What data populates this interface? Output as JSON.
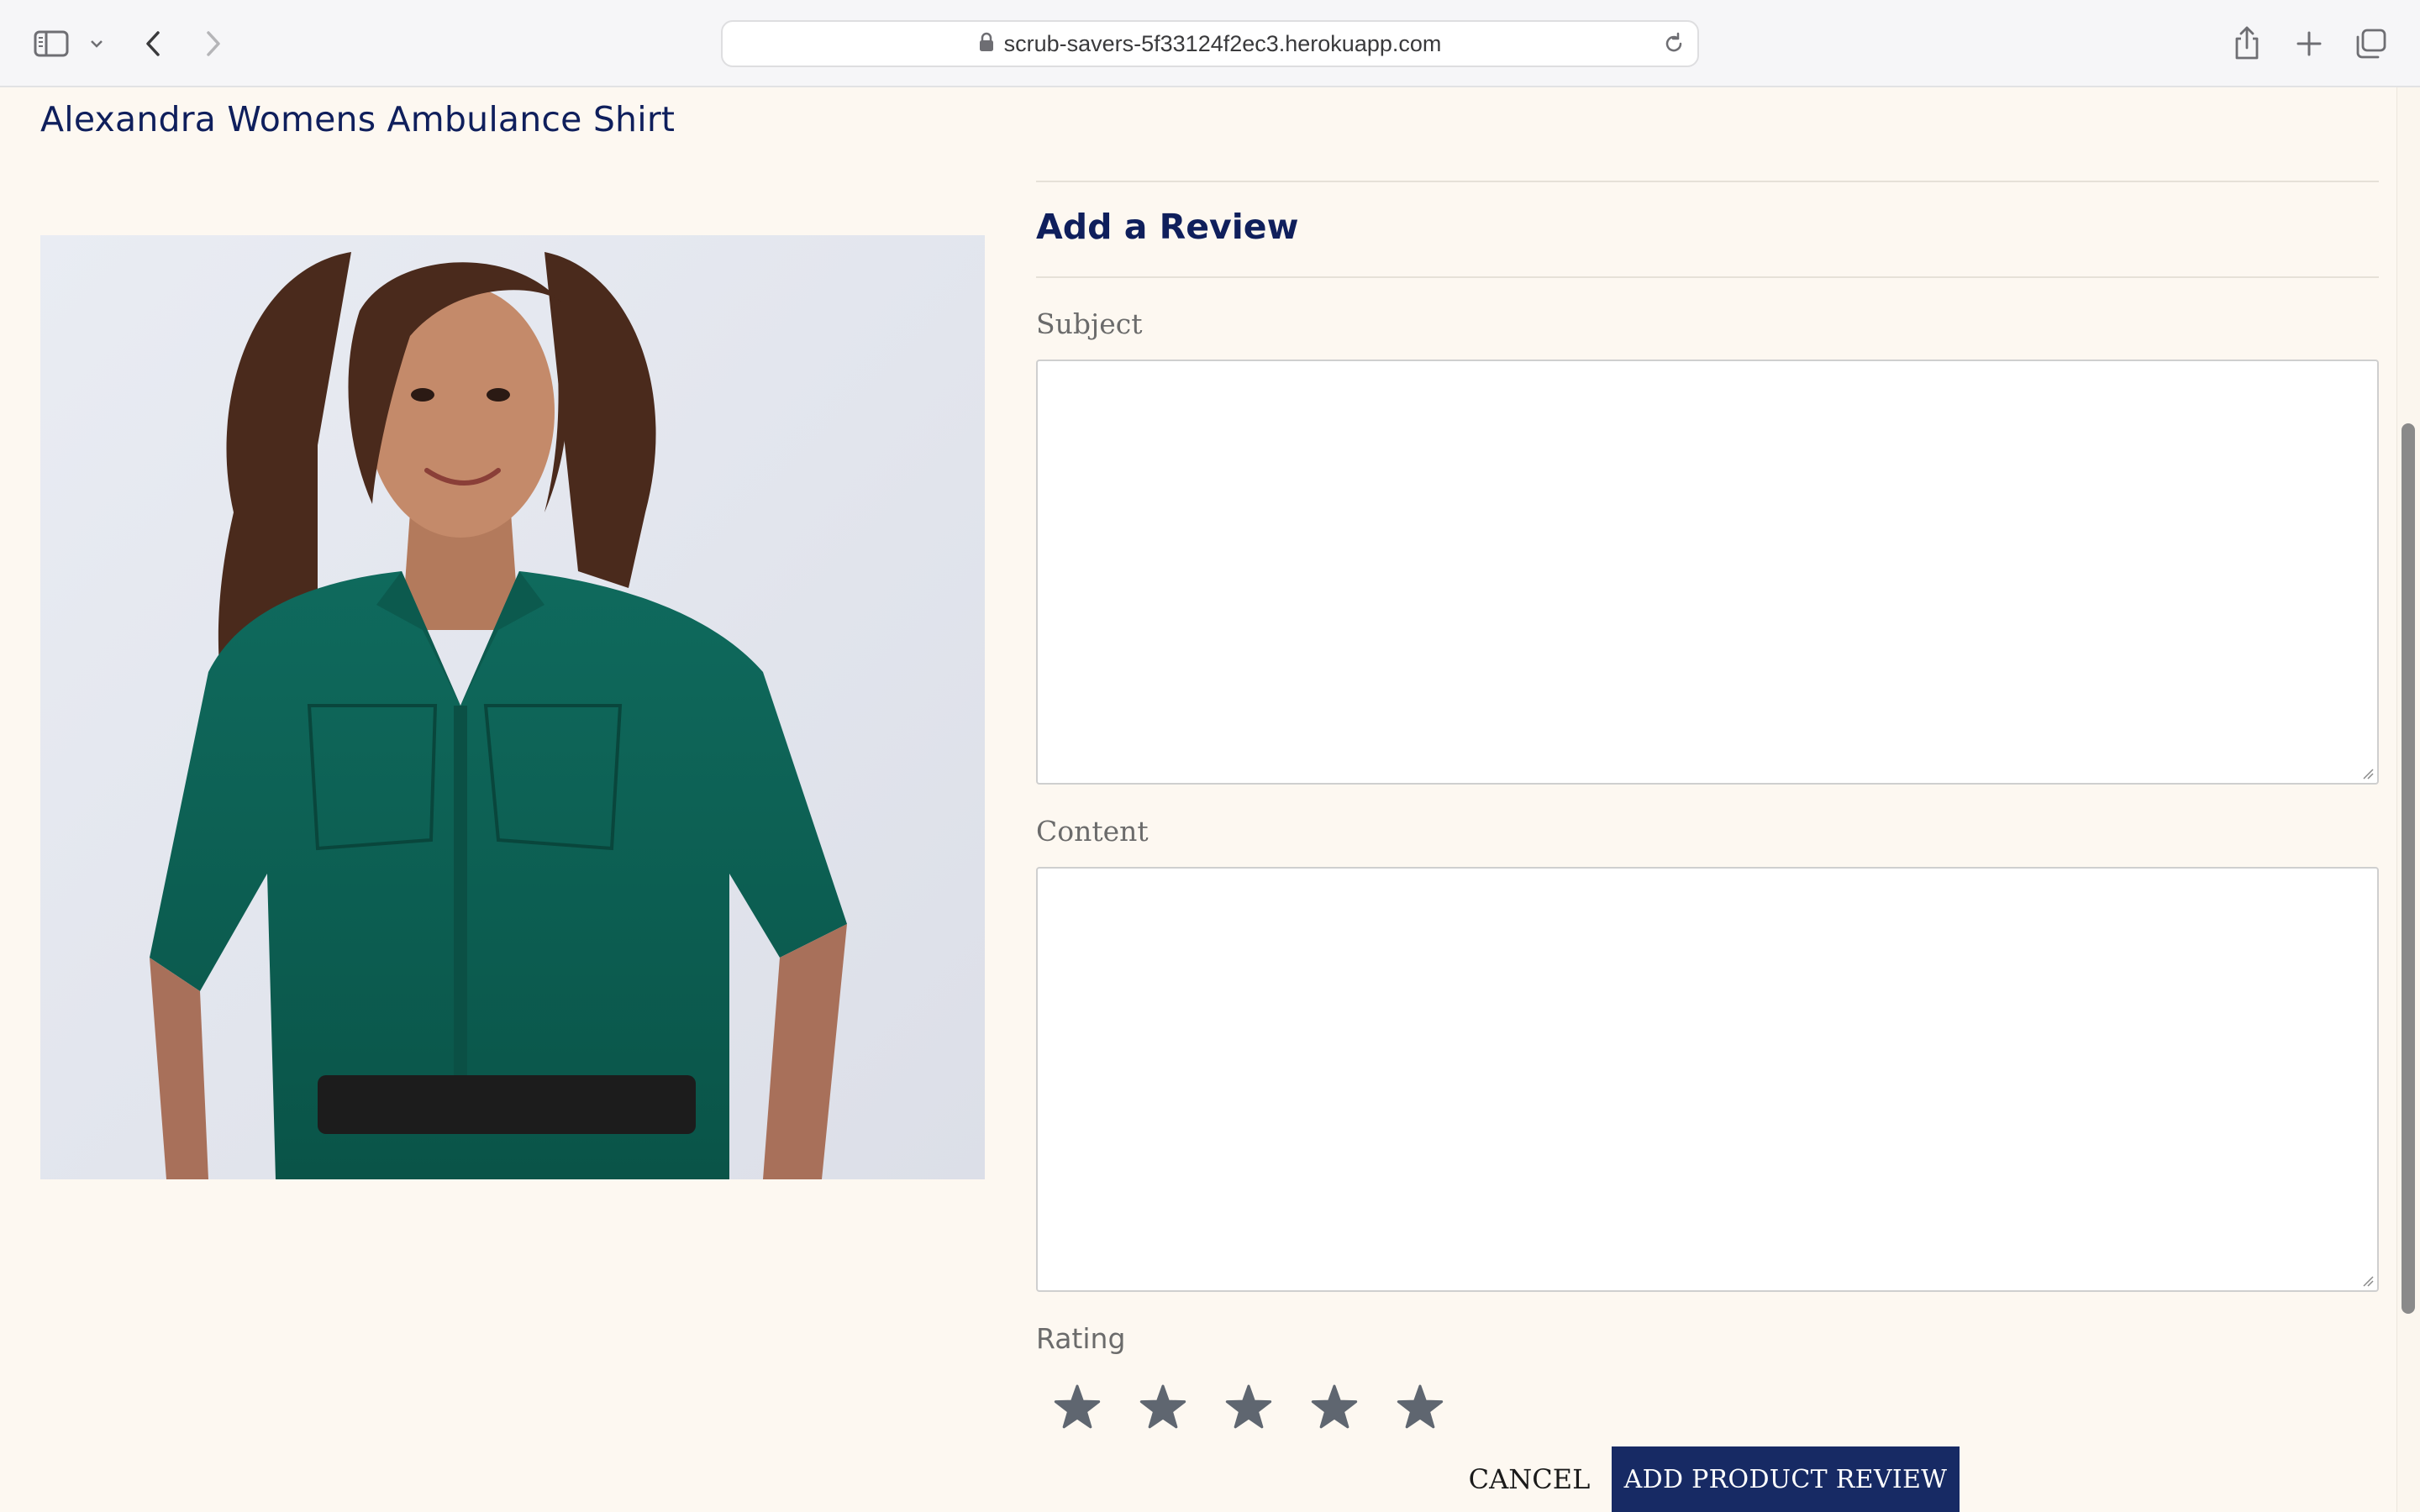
{
  "browser": {
    "url": "scrub-savers-5f33124f2ec3.herokuapp.com",
    "icons": [
      "sidebar-icon",
      "chevron-down-icon",
      "back-icon",
      "forward-icon",
      "lock-icon",
      "reload-icon",
      "share-icon",
      "plus-icon",
      "tabs-icon"
    ]
  },
  "product": {
    "title": "Alexandra Womens Ambulance Shirt"
  },
  "review_form": {
    "heading": "Add a Review",
    "subject_label": "Subject",
    "subject_value": "",
    "content_label": "Content",
    "content_value": "",
    "rating_label": "Rating",
    "rating_max": 5,
    "rating_value": 0,
    "cancel_label": "CANCEL",
    "submit_label": "ADD PRODUCT REVIEW"
  },
  "colors": {
    "page_bg": "#fdf8f1",
    "heading": "#0f1f5c",
    "button_bg": "#172a64",
    "star": "#5f6670"
  }
}
